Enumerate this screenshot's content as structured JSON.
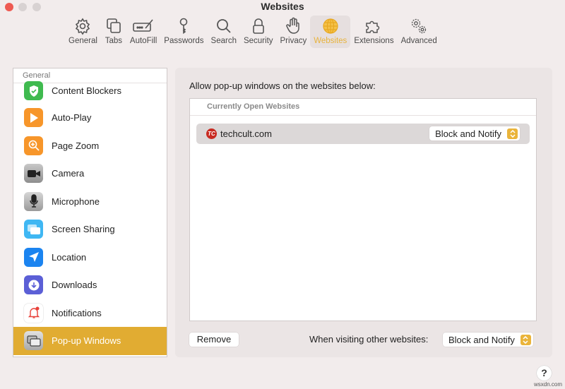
{
  "window": {
    "title": "Websites"
  },
  "toolbar": {
    "items": [
      {
        "label": "General",
        "icon": "gear-icon"
      },
      {
        "label": "Tabs",
        "icon": "tabs-icon"
      },
      {
        "label": "AutoFill",
        "icon": "autofill-icon"
      },
      {
        "label": "Passwords",
        "icon": "key-icon"
      },
      {
        "label": "Search",
        "icon": "search-icon"
      },
      {
        "label": "Security",
        "icon": "lock-icon"
      },
      {
        "label": "Privacy",
        "icon": "hand-icon"
      },
      {
        "label": "Websites",
        "icon": "globe-icon",
        "active": true
      },
      {
        "label": "Extensions",
        "icon": "puzzle-icon"
      },
      {
        "label": "Advanced",
        "icon": "gears-icon"
      }
    ],
    "active_color": "#e8b33c"
  },
  "sidebar": {
    "header": "General",
    "items": [
      {
        "label": "Content Blockers",
        "icon": "shield-check-icon",
        "color": "#3fba4f"
      },
      {
        "label": "Auto-Play",
        "icon": "play-icon",
        "color": "#f7962a"
      },
      {
        "label": "Page Zoom",
        "icon": "zoom-icon",
        "color": "#f7962a"
      },
      {
        "label": "Camera",
        "icon": "camera-icon",
        "color": "#8e8e8e"
      },
      {
        "label": "Microphone",
        "icon": "microphone-icon",
        "color": "#a8a8a8"
      },
      {
        "label": "Screen Sharing",
        "icon": "screen-sharing-icon",
        "color": "#3fb7f3"
      },
      {
        "label": "Location",
        "icon": "location-icon",
        "color": "#1b84f0"
      },
      {
        "label": "Downloads",
        "icon": "download-icon",
        "color": "#5b5fd6"
      },
      {
        "label": "Notifications",
        "icon": "bell-icon",
        "color": "#ffffff"
      },
      {
        "label": "Pop-up Windows",
        "icon": "popup-windows-icon",
        "color": "#b0b0b0",
        "selected": true
      }
    ],
    "selected_color": "#e1ac32"
  },
  "main": {
    "description": "Allow pop-up windows on the websites below:",
    "table_header": "Currently Open Websites",
    "rows": [
      {
        "site": "techcult.com",
        "favicon_text": "TC",
        "setting": "Block and Notify"
      }
    ],
    "remove_label": "Remove",
    "other_label": "When visiting other websites:",
    "other_setting": "Block and Notify"
  },
  "help_label": "?",
  "watermark": "wsxdn.com"
}
